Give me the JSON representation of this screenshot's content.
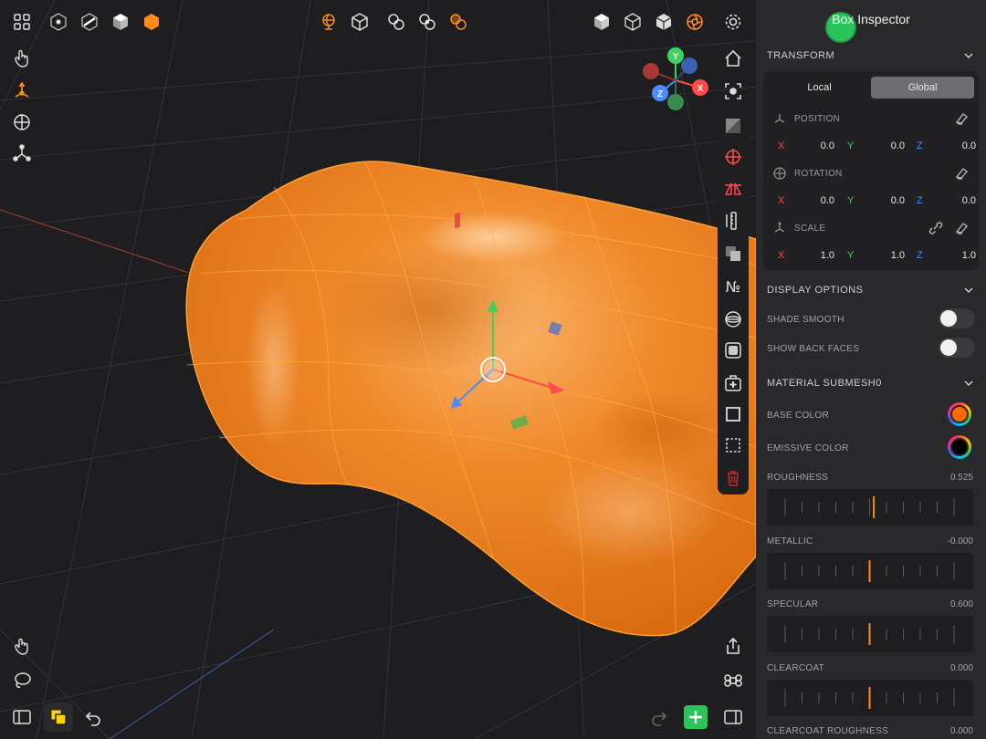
{
  "inspector": {
    "title": "Box Inspector",
    "transform": {
      "section_label": "TRANSFORM",
      "mode_local": "Local",
      "mode_global": "Global",
      "position": {
        "label": "POSITION",
        "x": "0.0",
        "y": "0.0",
        "z": "0.0"
      },
      "rotation": {
        "label": "ROTATION",
        "x": "0.0",
        "y": "0.0",
        "z": "0.0"
      },
      "scale": {
        "label": "SCALE",
        "x": "1.0",
        "y": "1.0",
        "z": "1.0"
      },
      "axis_x": "X",
      "axis_y": "Y",
      "axis_z": "Z"
    },
    "display": {
      "section_label": "DISPLAY OPTIONS",
      "shade_smooth": "SHADE SMOOTH",
      "shade_smooth_on": false,
      "show_back_faces": "SHOW BACK FACES",
      "show_back_faces_on": false
    },
    "material": {
      "section_label": "MATERIAL  SUBMESH0",
      "base_color_label": "BASE COLOR",
      "base_color": "#ff6a00",
      "emissive_label": "EMISSIVE COLOR",
      "emissive_color": "#000000",
      "roughness": {
        "label": "ROUGHNESS",
        "value": "0.525",
        "fraction": 0.525
      },
      "metallic": {
        "label": "METALLIC",
        "value": "-0.000",
        "fraction": 0.5
      },
      "specular": {
        "label": "SPECULAR",
        "value": "0.600",
        "fraction": 0.5
      },
      "clearcoat": {
        "label": "CLEARCOAT",
        "value": "0.000",
        "fraction": 0.5
      },
      "clearcoat_roughness": {
        "label": "CLEARCOAT ROUGHNESS",
        "value": "0.000"
      }
    }
  },
  "gizmo_labels": {
    "x": "X",
    "y": "Y",
    "z": "Z"
  },
  "toolbar_glyphs": {
    "number_tool": "№"
  },
  "colors": {
    "accent": "#ff8c1a",
    "mesh": "#f07e1f",
    "add_button": "#2bc45a"
  }
}
